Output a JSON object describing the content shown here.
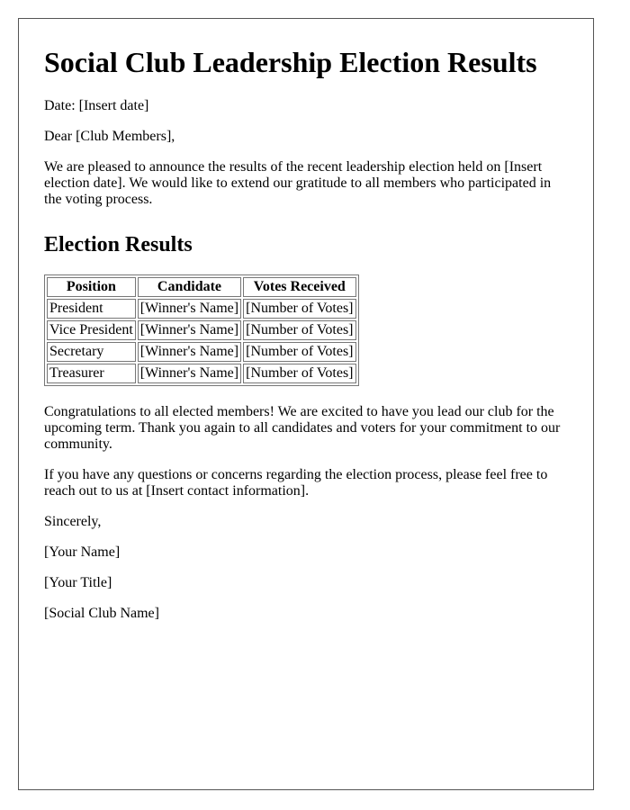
{
  "title": "Social Club Leadership Election Results",
  "date_line": "Date: [Insert date]",
  "salutation": "Dear [Club Members],",
  "intro": "We are pleased to announce the results of the recent leadership election held on [Insert election date]. We would like to extend our gratitude to all members who participated in the voting process.",
  "results_heading": "Election Results",
  "table": {
    "headers": [
      "Position",
      "Candidate",
      "Votes Received"
    ],
    "rows": [
      [
        "President",
        "[Winner's Name]",
        "[Number of Votes]"
      ],
      [
        "Vice President",
        "[Winner's Name]",
        "[Number of Votes]"
      ],
      [
        "Secretary",
        "[Winner's Name]",
        "[Number of Votes]"
      ],
      [
        "Treasurer",
        "[Winner's Name]",
        "[Number of Votes]"
      ]
    ]
  },
  "congrats": "Congratulations to all elected members! We are excited to have you lead our club for the upcoming term. Thank you again to all candidates and voters for your commitment to our community.",
  "contact": "If you have any questions or concerns regarding the election process, please feel free to reach out to us at [Insert contact information].",
  "closing": "Sincerely,",
  "signature": {
    "name": "[Your Name]",
    "title": "[Your Title]",
    "club": "[Social Club Name]"
  }
}
